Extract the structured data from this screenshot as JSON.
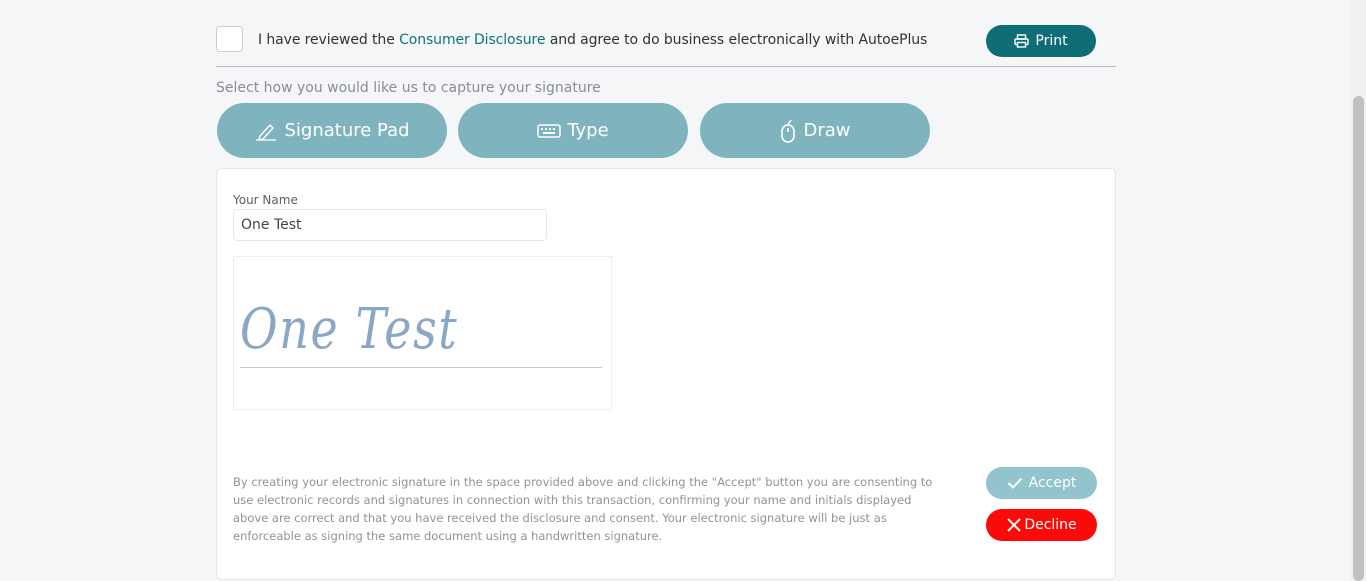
{
  "consent": {
    "text_before": "I have reviewed the ",
    "link_text": "Consumer Disclosure",
    "text_after": " and agree to do business electronically with AutoePlus",
    "checked": false
  },
  "print": {
    "label": "Print",
    "icon": "printer-icon"
  },
  "capture": {
    "prompt": "Select how you would like us to capture your signature",
    "methods": [
      {
        "label": "Signature Pad",
        "icon": "pen-icon"
      },
      {
        "label": "Type",
        "icon": "keyboard-icon"
      },
      {
        "label": "Draw",
        "icon": "mouse-icon"
      }
    ]
  },
  "form": {
    "name_label": "Your Name",
    "name_value": "One Test",
    "signature_preview": "One Test"
  },
  "disclaimer": "By creating your electronic signature in the space provided above and clicking the \"Accept\" button you are consenting to use electronic records and signatures in connection with this transaction, confirming your name and initials displayed above are correct and that you have received the disclosure and consent. Your electronic signature will be just as enforceable as signing the same document using a handwritten signature.",
  "actions": {
    "accept_label": "Accept",
    "decline_label": "Decline"
  },
  "colors": {
    "primary": "#0f6d78",
    "method_button": "#7fb4bf",
    "accept": "#93c3cc",
    "decline": "#fb0a0a",
    "signature_ink": "#8aa8c4"
  }
}
